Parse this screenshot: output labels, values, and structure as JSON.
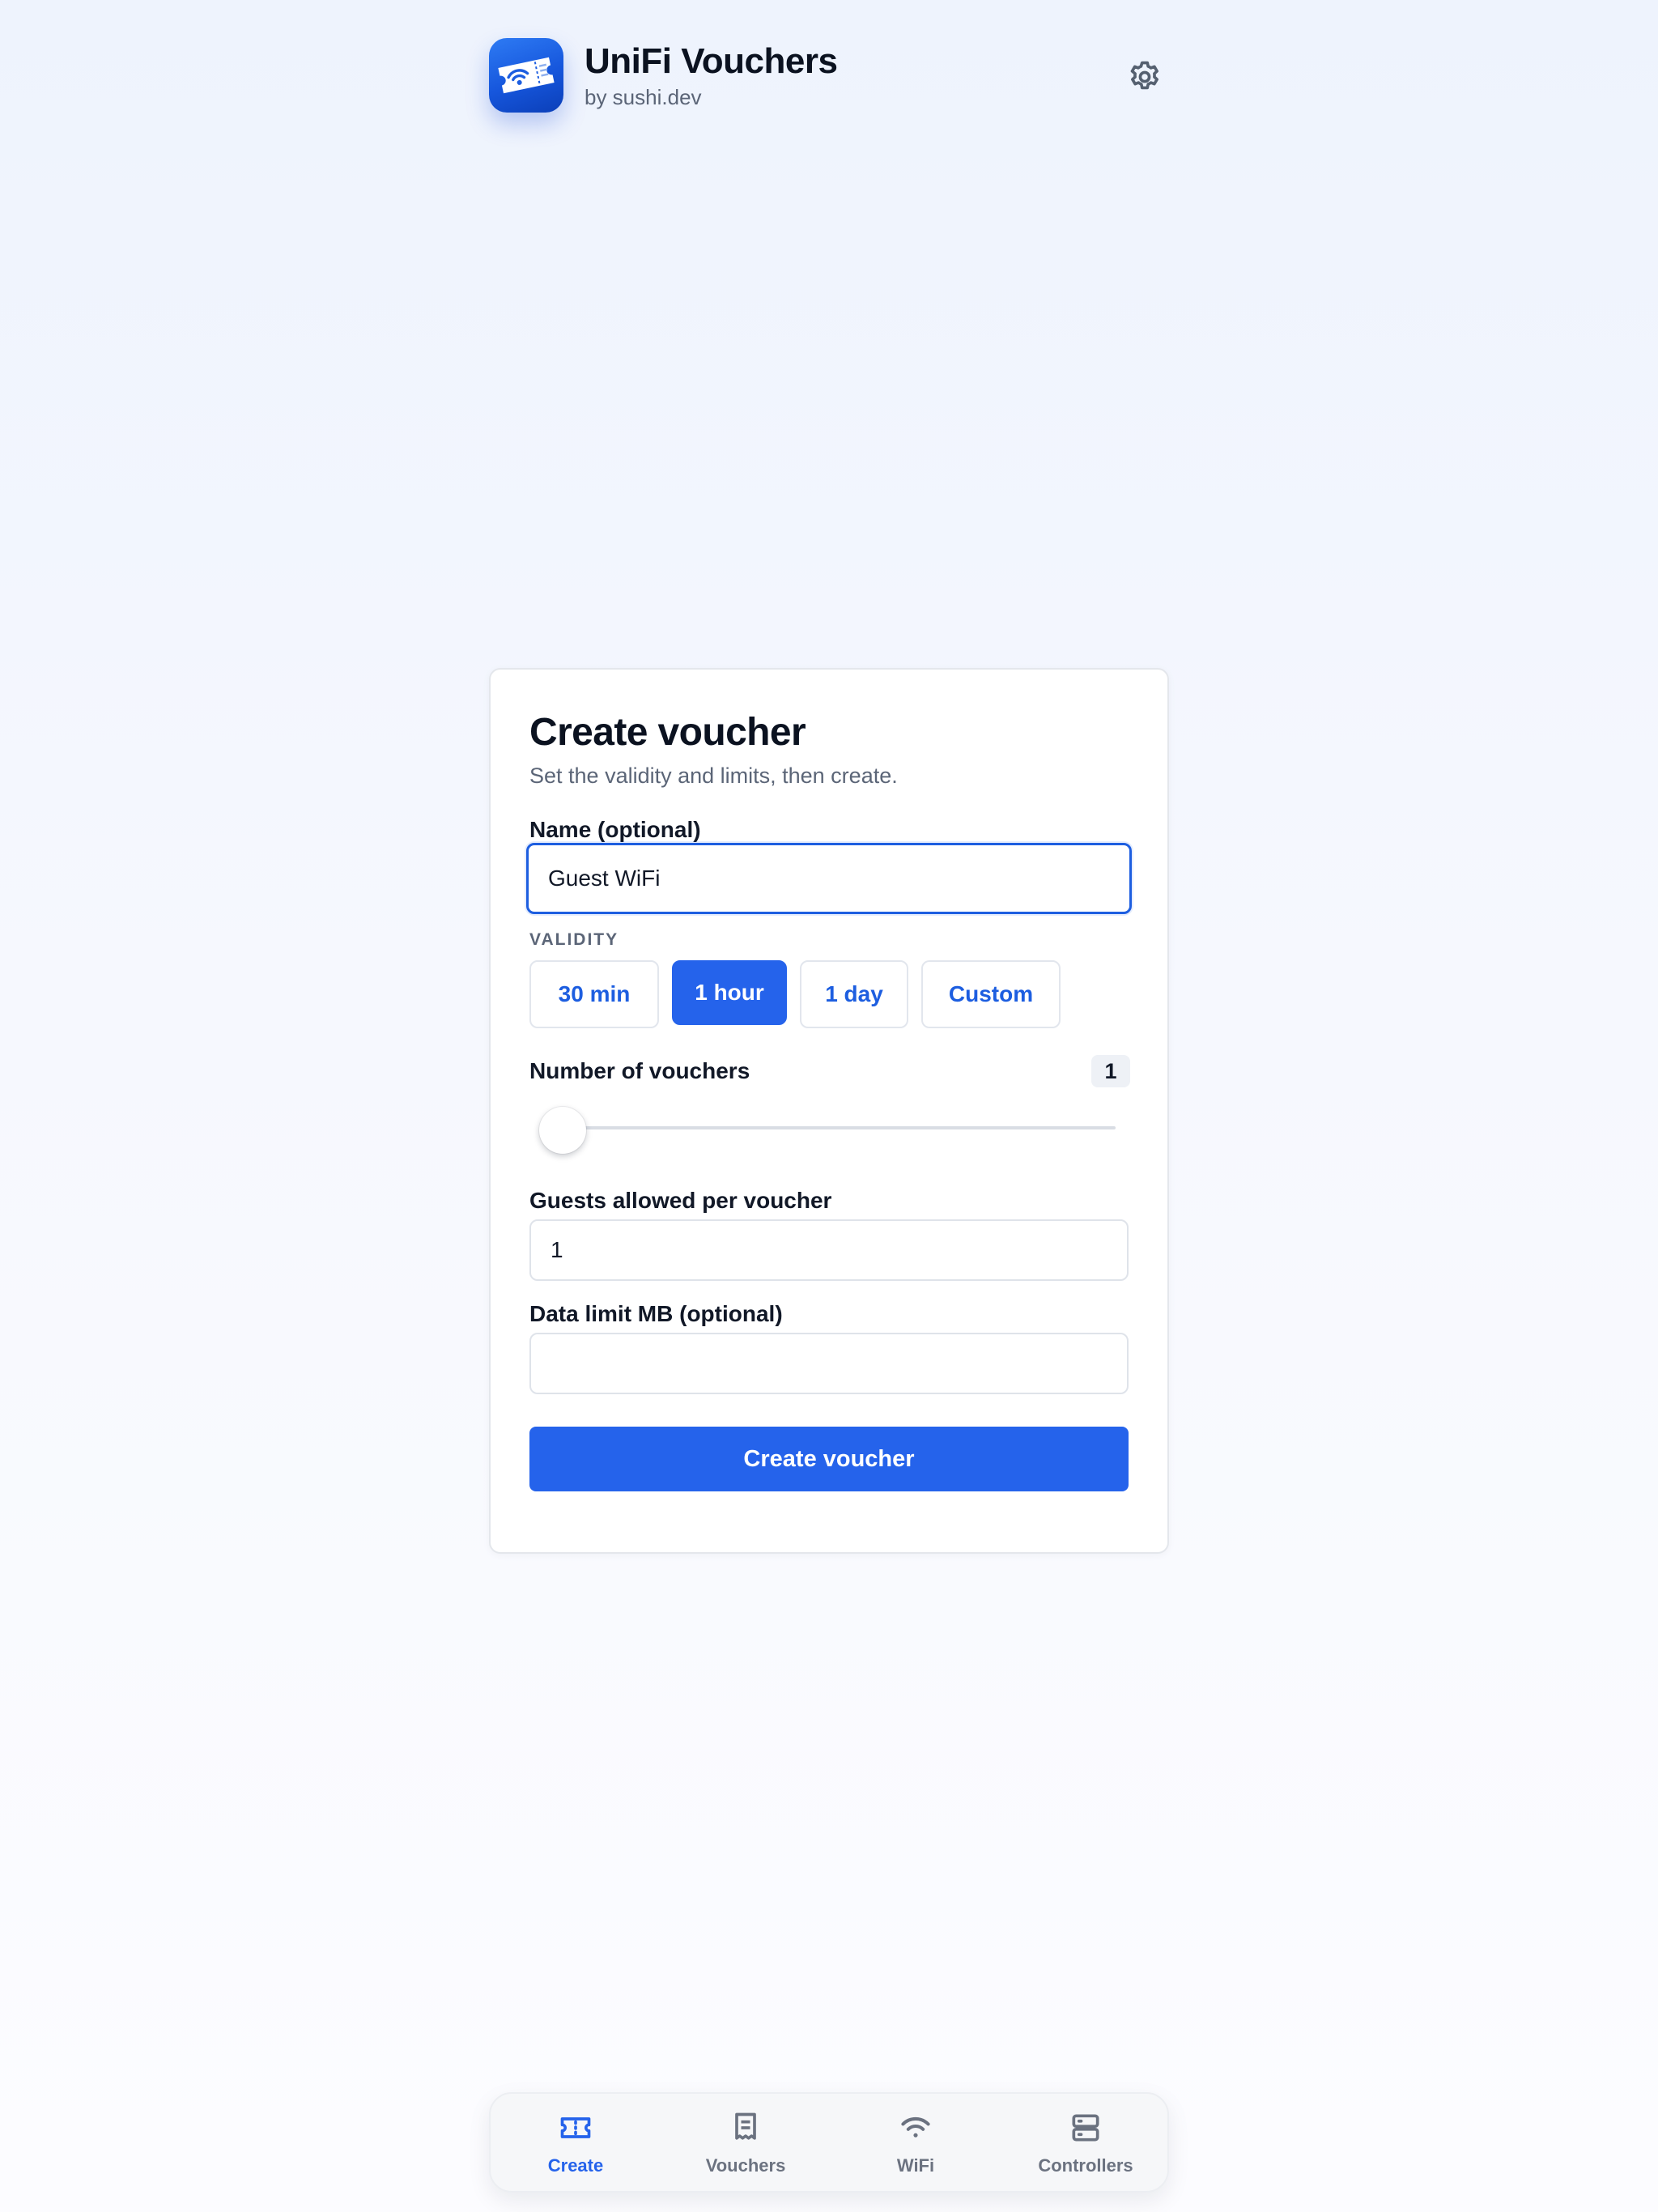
{
  "app": {
    "title": "UniFi Vouchers",
    "subtitle": "by sushi.dev",
    "icon": "voucher-wifi-icon",
    "settings_icon": "gear-icon"
  },
  "form": {
    "title": "Create voucher",
    "subtitle": "Set the validity and limits, then create.",
    "name_label": "Name (optional)",
    "name_value": "Guest WiFi",
    "validity_label": "VALIDITY",
    "validity_options": [
      "30 min",
      "1 hour",
      "1 day",
      "Custom"
    ],
    "validity_selected": "1 hour",
    "count_label": "Number of vouchers",
    "count_value": "1",
    "count_slider_fraction": 0,
    "guests_label": "Guests allowed per voucher",
    "guests_value": "1",
    "data_limit_label": "Data limit MB (optional)",
    "data_limit_value": "",
    "submit_label": "Create voucher"
  },
  "nav": {
    "items": [
      {
        "label": "Create",
        "icon": "ticket-icon",
        "active": true
      },
      {
        "label": "Vouchers",
        "icon": "receipt-icon",
        "active": false
      },
      {
        "label": "WiFi",
        "icon": "wifi-icon",
        "active": false
      },
      {
        "label": "Controllers",
        "icon": "server-icon",
        "active": false
      }
    ]
  },
  "colors": {
    "accent": "#2563eb",
    "text": "#111827",
    "muted": "#5b6577",
    "nav_inactive": "#6b7280"
  }
}
